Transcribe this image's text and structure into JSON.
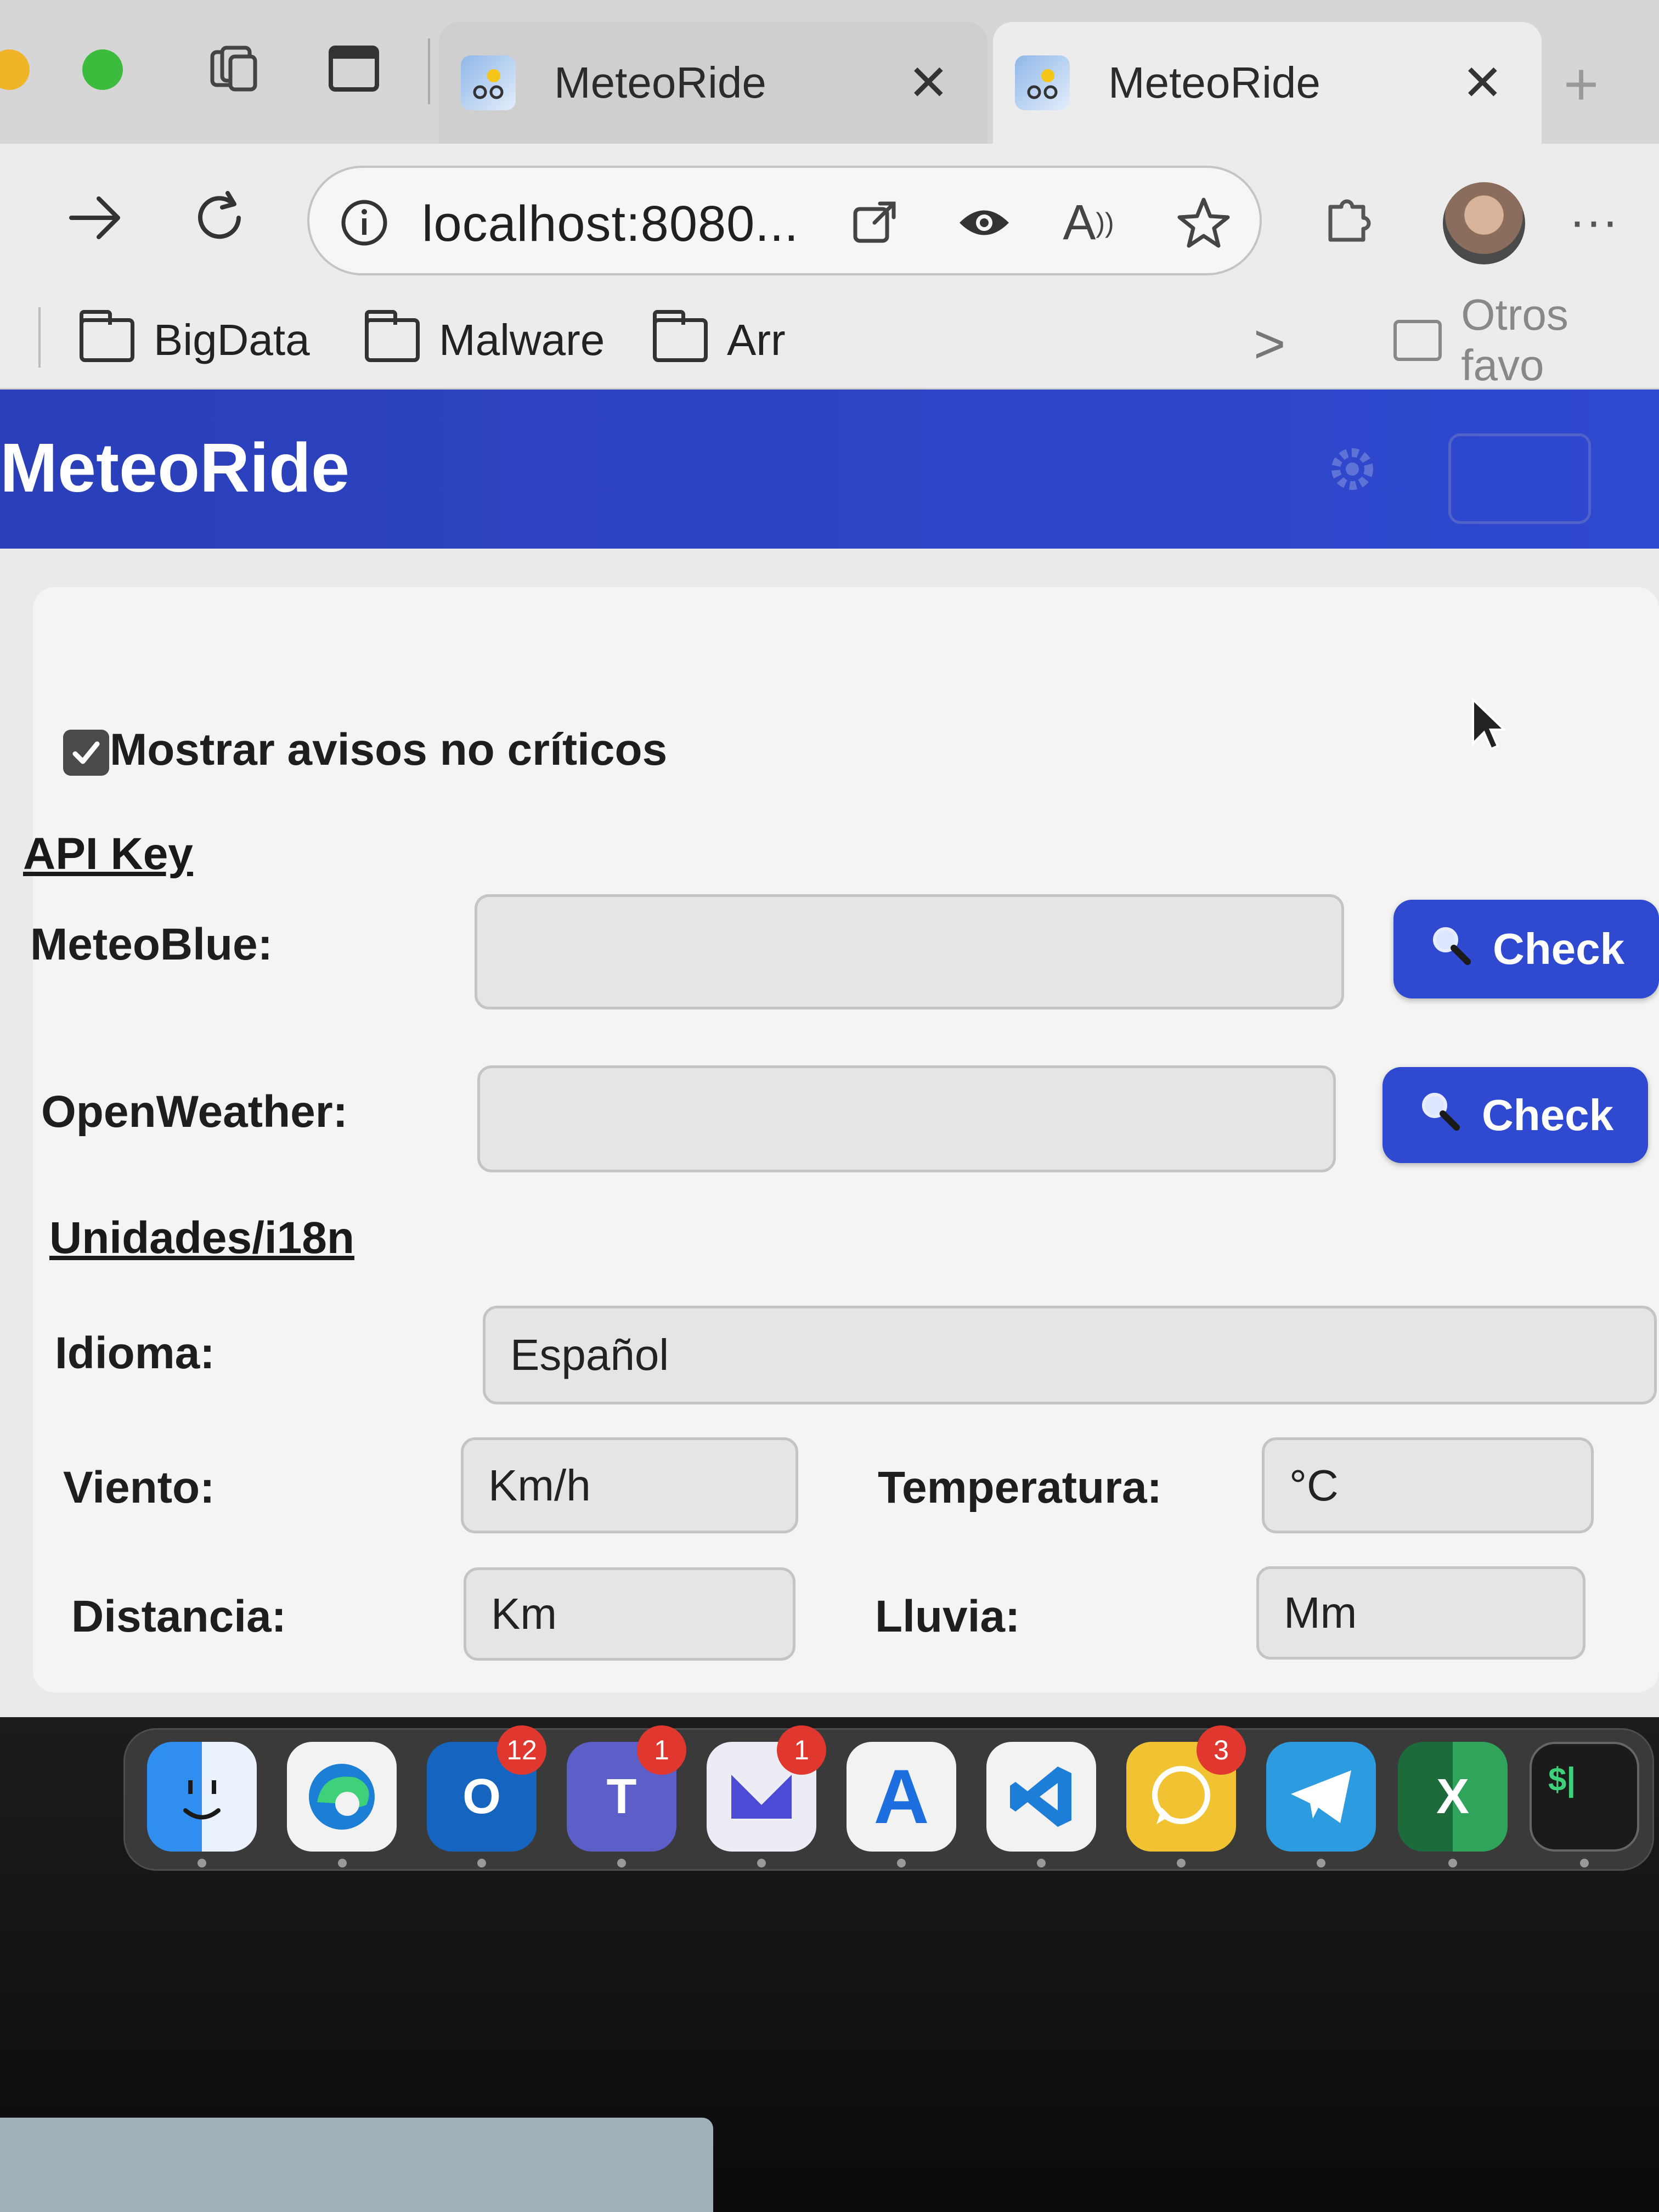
{
  "browser": {
    "tabs": [
      {
        "title": "MeteoRide",
        "active": false
      },
      {
        "title": "MeteoRide",
        "active": true
      }
    ],
    "url": "localhost:8080...",
    "bookmarks": [
      "BigData",
      "Malware",
      "Arr"
    ],
    "other_bookmarks": "Otros favo"
  },
  "app": {
    "title": "MeteoRide",
    "show_warnings": {
      "label": "Mostrar avisos no críticos",
      "checked": true
    },
    "api_section": "API Key",
    "meteoblue": {
      "label": "MeteoBlue:",
      "value": "",
      "button": "Check"
    },
    "openweather": {
      "label": "OpenWeather:",
      "value": "",
      "button": "Check"
    },
    "units_section": "Unidades/i18n",
    "language": {
      "label": "Idioma:",
      "value": "Español"
    },
    "wind": {
      "label": "Viento:",
      "value": "Km/h"
    },
    "temperature": {
      "label": "Temperatura:",
      "value": "°C"
    },
    "distance": {
      "label": "Distancia:",
      "value": "Km"
    },
    "rain": {
      "label": "Lluvia:",
      "value": "Mm"
    }
  },
  "dock": {
    "apps": [
      {
        "name": "finder",
        "badge": ""
      },
      {
        "name": "edge",
        "badge": ""
      },
      {
        "name": "outlook",
        "badge": "12",
        "glyph": "O"
      },
      {
        "name": "teams",
        "badge": "1",
        "glyph": "T"
      },
      {
        "name": "mail",
        "badge": "1",
        "glyph": ""
      },
      {
        "name": "app-store",
        "badge": "",
        "glyph": "A"
      },
      {
        "name": "vscode",
        "badge": "",
        "glyph": ""
      },
      {
        "name": "whatsapp",
        "badge": "3",
        "glyph": ""
      },
      {
        "name": "telegram",
        "badge": "",
        "glyph": ""
      },
      {
        "name": "excel",
        "badge": "",
        "glyph": "X"
      },
      {
        "name": "terminal",
        "badge": "",
        "glyph": "$|"
      }
    ]
  },
  "colors": {
    "brand": "#2f49d0",
    "header": "#2a3fb8"
  }
}
